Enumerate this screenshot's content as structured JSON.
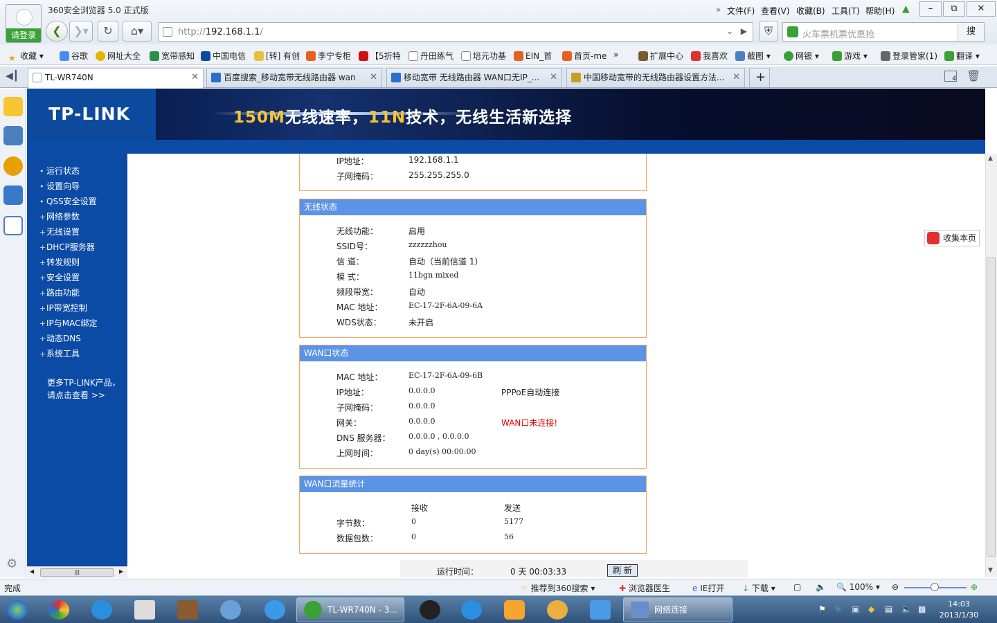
{
  "browser": {
    "title": "360安全浏览器 5.0 正式版",
    "login": "请登录",
    "menus": [
      "文件(F)",
      "查看(V)",
      "收藏(B)",
      "工具(T)",
      "帮助(H)"
    ],
    "address_url": "http://192.168.1.1/",
    "address_host": "192.168.1.1",
    "search_placeholder": "火车票机票优惠抢",
    "search_button": "搜",
    "bookmarks": [
      "收藏",
      "谷歌",
      "网址大全",
      "宽带感知",
      "中国电信",
      "[转] 有创",
      "李宁专柜",
      "【5折特",
      "丹田练气",
      "培元功基",
      "EIN_首",
      "首页-me",
      "»",
      "扩展中心",
      "我喜欢",
      "截图",
      "网银",
      "游戏",
      "登录管家(1)",
      "翻译"
    ],
    "tabs": [
      {
        "label": "TL-WR740N",
        "active": true
      },
      {
        "label": "百度搜索_移动宽带无线路由器 wan",
        "active": false
      },
      {
        "label": "移动宽带 无线路由器 WAN口无IP_...",
        "active": false
      },
      {
        "label": "中国移动宽带的无线路由器设置方法...",
        "active": false
      }
    ],
    "tab_count": "4",
    "fav_page_button": "收集本页"
  },
  "router": {
    "logo": "TP-LINK",
    "banner_part1": "150M",
    "banner_part2": "无线速率，",
    "banner_part3": "11N",
    "banner_part4": "技术，无线生活新选择",
    "nav": [
      "运行状态",
      "设置向导",
      "QSS安全设置",
      "网络参数",
      "无线设置",
      "DHCP服务器",
      "转发规则",
      "安全设置",
      "路由功能",
      "IP带宽控制",
      "IP与MAC绑定",
      "动态DNS",
      "系统工具"
    ],
    "nav_bullets": [
      "•",
      "•",
      "•",
      "+",
      "+",
      "+",
      "+",
      "+",
      "+",
      "+",
      "+",
      "+",
      "+"
    ],
    "more_line1": "更多TP-LINK产品，",
    "more_line2": "请点击查看 >>",
    "lan": {
      "ip_label": "IP地址：",
      "ip": "192.168.1.1",
      "mask_label": "子网掩码：",
      "mask": "255.255.255.0"
    },
    "wireless": {
      "title": "无线状态",
      "func_label": "无线功能：",
      "func": "启用",
      "ssid_label": "SSID号：",
      "ssid": "zzzzzzhou",
      "channel_label": "信 道：",
      "channel": "自动（当前信道 1）",
      "mode_label": "模 式：",
      "mode": "11bgn mixed",
      "bw_label": "频段带宽：",
      "bw": "自动",
      "mac_label": "MAC 地址：",
      "mac": "EC-17-2F-6A-09-6A",
      "wds_label": "WDS状态：",
      "wds": "未开启"
    },
    "wan": {
      "title": "WAN口状态",
      "mac_label": "MAC 地址：",
      "mac": "EC-17-2F-6A-09-6B",
      "ip_label": "IP地址：",
      "ip": "0.0.0.0",
      "conn_type": "PPPoE自动连接",
      "mask_label": "子网掩码：",
      "mask": "0.0.0.0",
      "gw_label": "网关：",
      "gw": "0.0.0.0",
      "status": "WAN口未连接!",
      "dns_label": "DNS 服务器：",
      "dns": "0.0.0.0 , 0.0.0.0",
      "uptime_label": "上网时间：",
      "uptime": "0 day(s) 00:00:00"
    },
    "traffic": {
      "title": "WAN口流量统计",
      "recv_header": "接收",
      "send_header": "发送",
      "bytes_label": "字节数：",
      "bytes_recv": "0",
      "bytes_send": "5177",
      "packets_label": "数据包数：",
      "packets_recv": "0",
      "packets_send": "56"
    },
    "runtime_label": "运行时间：",
    "runtime": "0 天 00:03:33",
    "refresh_button": "刷 新"
  },
  "statusbar": {
    "status": "完成",
    "recommend": "推荐到360搜索",
    "doctor": "浏览器医生",
    "ie_open": "IE打开",
    "download": "下载",
    "zoom": "100%"
  },
  "taskbar": {
    "active_window": "TL-WR740N - 3...",
    "network_window": "网络连接",
    "time": "14:03",
    "date": "2013/1/30"
  }
}
